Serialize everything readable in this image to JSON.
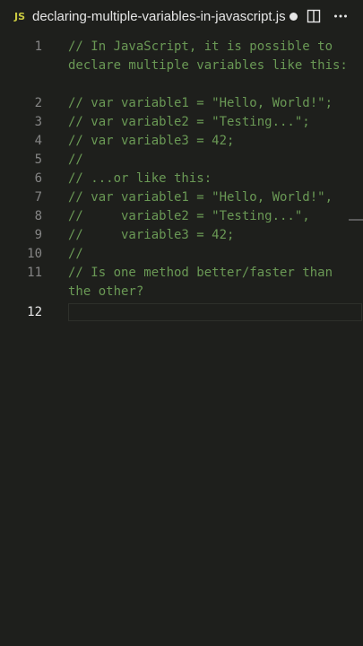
{
  "tab": {
    "lang_badge": "JS",
    "title": "declaring-multiple-variables-in-javascript.js",
    "icons": [
      "dirty-indicator-icon",
      "split-editor-icon",
      "more-actions-icon"
    ]
  },
  "editor": {
    "comment_color": "#6a9955",
    "lines": [
      {
        "num": "1",
        "text": "// In JavaScript, it is possible to declare multiple variables like this:"
      },
      {
        "num": "2",
        "text": "// var variable1 = \"Hello, World!\";"
      },
      {
        "num": "3",
        "text": "// var variable2 = \"Testing...\";"
      },
      {
        "num": "4",
        "text": "// var variable3 = 42;"
      },
      {
        "num": "5",
        "text": "//"
      },
      {
        "num": "6",
        "text": "// ...or like this:"
      },
      {
        "num": "7",
        "text": "// var variable1 = \"Hello, World!\","
      },
      {
        "num": "8",
        "text": "//     variable2 = \"Testing...\","
      },
      {
        "num": "9",
        "text": "//     variable3 = 42;"
      },
      {
        "num": "10",
        "text": "//"
      },
      {
        "num": "11",
        "text": "// Is one method better/faster than the other?"
      },
      {
        "num": "12",
        "text": ""
      }
    ]
  }
}
